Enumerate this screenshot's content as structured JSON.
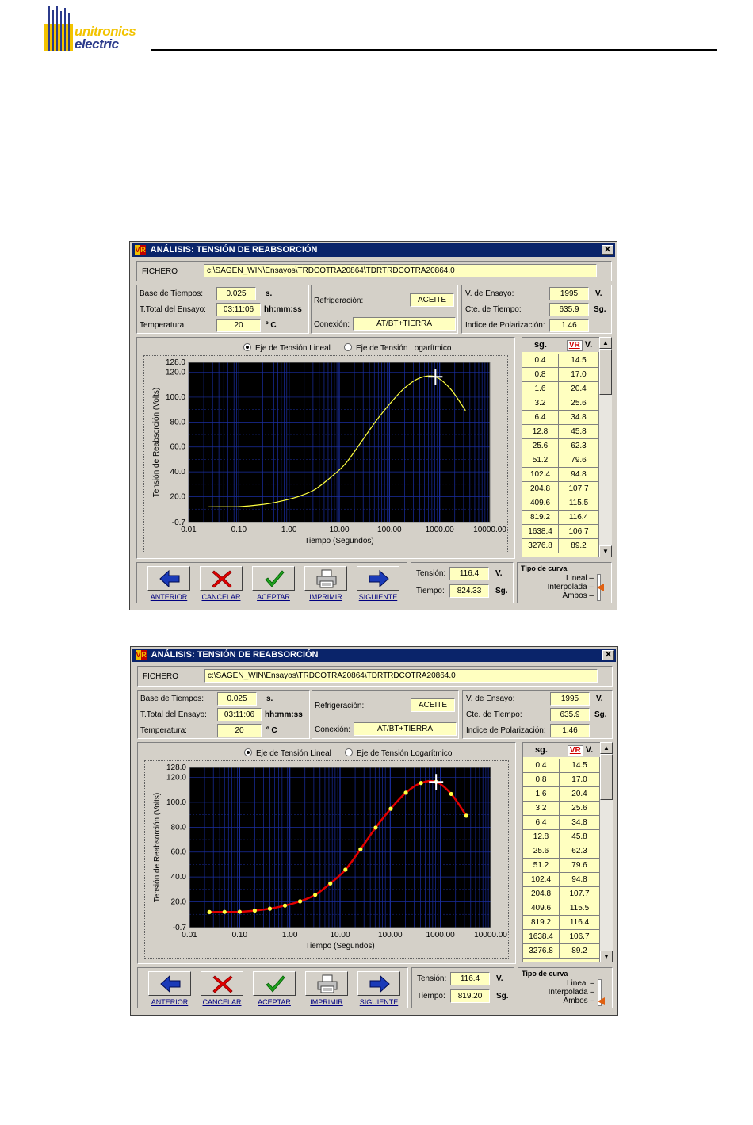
{
  "logo": {
    "line1": "unitronics",
    "line2": "electric"
  },
  "windows": [
    {
      "title": "ANÁLISIS: TENSIÓN DE REABSORCIÓN",
      "app_icon": "VR",
      "close": "✕",
      "fichero_label": "FICHERO",
      "fichero_path": "c:\\SAGEN_WIN\\Ensayos\\TRDCOTRA20864\\TDRTRDCOTRA20864.0",
      "fields": {
        "base_tiempos_label": "Base de Tiempos:",
        "base_tiempos_value": "0.025",
        "base_tiempos_unit": "s.",
        "total_ensayo_label": "T.Total del Ensayo:",
        "total_ensayo_value": "03:11:06",
        "total_ensayo_unit": "hh:mm:ss",
        "temperatura_label": "Temperatura:",
        "temperatura_value": "20",
        "temperatura_unit": "º C",
        "refrigeracion_label": "Refrigeración:",
        "refrigeracion_value": "ACEITE",
        "conexion_label": "Conexión:",
        "conexion_value": "AT/BT+TIERRA",
        "v_ensayo_label": "V. de Ensayo:",
        "v_ensayo_value": "1995",
        "v_ensayo_unit": "V.",
        "cte_tiempo_label": "Cte. de Tiempo:",
        "cte_tiempo_value": "635.9",
        "cte_tiempo_unit": "Sg.",
        "indice_pol_label": "Indice de Polarización:",
        "indice_pol_value": "1.46"
      },
      "radio_lineal": "Eje de Tensión Lineal",
      "radio_log": "Eje de Tensión Logarítmico",
      "radio_selected": "lineal",
      "table_headers": {
        "sg": "sg.",
        "vr": "VR",
        "v": "V."
      },
      "table_rows": [
        [
          "0.4",
          "14.5"
        ],
        [
          "0.8",
          "17.0"
        ],
        [
          "1.6",
          "20.4"
        ],
        [
          "3.2",
          "25.6"
        ],
        [
          "6.4",
          "34.8"
        ],
        [
          "12.8",
          "45.8"
        ],
        [
          "25.6",
          "62.3"
        ],
        [
          "51.2",
          "79.6"
        ],
        [
          "102.4",
          "94.8"
        ],
        [
          "204.8",
          "107.7"
        ],
        [
          "409.6",
          "115.5"
        ],
        [
          "819.2",
          "116.4"
        ],
        [
          "1638.4",
          "106.7"
        ],
        [
          "3276.8",
          "89.2"
        ]
      ],
      "buttons": [
        "ANTERIOR",
        "CANCELAR",
        "ACEPTAR",
        "IMPRIMIR",
        "SIGUIENTE"
      ],
      "readout": {
        "tension_label": "Tensión:",
        "tension_value": "116.4",
        "tension_unit": "V.",
        "tiempo_label": "Tiempo:",
        "tiempo_value": "824.33",
        "tiempo_unit": "Sg."
      },
      "tipo_curva": {
        "title": "Tipo de curva",
        "options": [
          "Lineal –",
          "Interpolada –",
          "Ambos –"
        ],
        "selected": "Interpolada –"
      },
      "chart_data": {
        "type": "line",
        "xlabel": "Tiempo (Segundos)",
        "ylabel": "Tensión de Reabsorción (Volts)",
        "x_scale": "log",
        "xlim": [
          0.01,
          10000
        ],
        "ylim": [
          -0.7,
          128.0
        ],
        "x_ticks": [
          "0.01",
          "0.10",
          "1.00",
          "10.00",
          "100.00",
          "1000.00",
          "10000.00"
        ],
        "y_ticks": [
          "-0.7",
          "20.0",
          "40.0",
          "60.0",
          "80.0",
          "100.0",
          "120.0",
          "128.0"
        ],
        "grid": true,
        "background": "#000000",
        "grid_color": "#1a2ea0",
        "series": [
          {
            "color": "#ffff40",
            "markers": false,
            "x": [
              0.025,
              0.05,
              0.1,
              0.2,
              0.4,
              0.8,
              1.6,
              3.2,
              6.4,
              12.8,
              25.6,
              51.2,
              102.4,
              204.8,
              409.6,
              819.2,
              1638.4,
              3276.8
            ],
            "y": [
              11.8,
              11.9,
              12.0,
              13.0,
              14.5,
              17.0,
              20.4,
              25.6,
              34.8,
              45.8,
              62.3,
              79.6,
              94.8,
              107.7,
              115.5,
              116.4,
              106.7,
              89.2
            ]
          }
        ],
        "cursor": {
          "x": 824.33,
          "y": 116.4
        }
      }
    },
    {
      "title": "ANÁLISIS: TENSIÓN DE REABSORCIÓN",
      "app_icon": "VR",
      "close": "✕",
      "fichero_label": "FICHERO",
      "fichero_path": "c:\\SAGEN_WIN\\Ensayos\\TRDCOTRA20864\\TDRTRDCOTRA20864.0",
      "fields": {
        "base_tiempos_label": "Base de Tiempos:",
        "base_tiempos_value": "0.025",
        "base_tiempos_unit": "s.",
        "total_ensayo_label": "T.Total del Ensayo:",
        "total_ensayo_value": "03:11:06",
        "total_ensayo_unit": "hh:mm:ss",
        "temperatura_label": "Temperatura:",
        "temperatura_value": "20",
        "temperatura_unit": "º C",
        "refrigeracion_label": "Refrigeración:",
        "refrigeracion_value": "ACEITE",
        "conexion_label": "Conexión:",
        "conexion_value": "AT/BT+TIERRA",
        "v_ensayo_label": "V. de Ensayo:",
        "v_ensayo_value": "1995",
        "v_ensayo_unit": "V.",
        "cte_tiempo_label": "Cte. de Tiempo:",
        "cte_tiempo_value": "635.9",
        "cte_tiempo_unit": "Sg.",
        "indice_pol_label": "Indice de Polarización:",
        "indice_pol_value": "1.46"
      },
      "radio_lineal": "Eje de Tensión Lineal",
      "radio_log": "Eje de Tensión Logarítmico",
      "radio_selected": "lineal",
      "table_headers": {
        "sg": "sg.",
        "vr": "VR",
        "v": "V."
      },
      "table_rows": [
        [
          "0.4",
          "14.5"
        ],
        [
          "0.8",
          "17.0"
        ],
        [
          "1.6",
          "20.4"
        ],
        [
          "3.2",
          "25.6"
        ],
        [
          "6.4",
          "34.8"
        ],
        [
          "12.8",
          "45.8"
        ],
        [
          "25.6",
          "62.3"
        ],
        [
          "51.2",
          "79.6"
        ],
        [
          "102.4",
          "94.8"
        ],
        [
          "204.8",
          "107.7"
        ],
        [
          "409.6",
          "115.5"
        ],
        [
          "819.2",
          "116.4"
        ],
        [
          "1638.4",
          "106.7"
        ],
        [
          "3276.8",
          "89.2"
        ]
      ],
      "buttons": [
        "ANTERIOR",
        "CANCELAR",
        "ACEPTAR",
        "IMPRIMIR",
        "SIGUIENTE"
      ],
      "readout": {
        "tension_label": "Tensión:",
        "tension_value": "116.4",
        "tension_unit": "V.",
        "tiempo_label": "Tiempo:",
        "tiempo_value": "819.20",
        "tiempo_unit": "Sg."
      },
      "tipo_curva": {
        "title": "Tipo de curva",
        "options": [
          "Lineal –",
          "Interpolada –",
          "Ambos –"
        ],
        "selected": "Ambos –"
      },
      "chart_data": {
        "type": "line",
        "xlabel": "Tiempo (Segundos)",
        "ylabel": "Tensión de Reabsorción (Volts)",
        "x_scale": "log",
        "xlim": [
          0.01,
          10000
        ],
        "ylim": [
          -0.7,
          128.0
        ],
        "x_ticks": [
          "0.01",
          "0.10",
          "1.00",
          "10.00",
          "100.00",
          "1000.00",
          "10000.00"
        ],
        "y_ticks": [
          "-0.7",
          "20.0",
          "40.0",
          "60.0",
          "80.0",
          "100.0",
          "120.0",
          "128.0"
        ],
        "grid": true,
        "background": "#000000",
        "grid_color": "#1a2ea0",
        "series": [
          {
            "color": "#e00000",
            "marker_color": "#ffff40",
            "markers": true,
            "x": [
              0.025,
              0.05,
              0.1,
              0.2,
              0.4,
              0.8,
              1.6,
              3.2,
              6.4,
              12.8,
              25.6,
              51.2,
              102.4,
              204.8,
              409.6,
              819.2,
              1638.4,
              3276.8
            ],
            "y": [
              11.8,
              11.9,
              12.0,
              13.0,
              14.5,
              17.0,
              20.4,
              25.6,
              34.8,
              45.8,
              62.3,
              79.6,
              94.8,
              107.7,
              115.5,
              116.4,
              106.7,
              89.2
            ]
          }
        ],
        "cursor": {
          "x": 819.2,
          "y": 116.4
        }
      }
    }
  ]
}
